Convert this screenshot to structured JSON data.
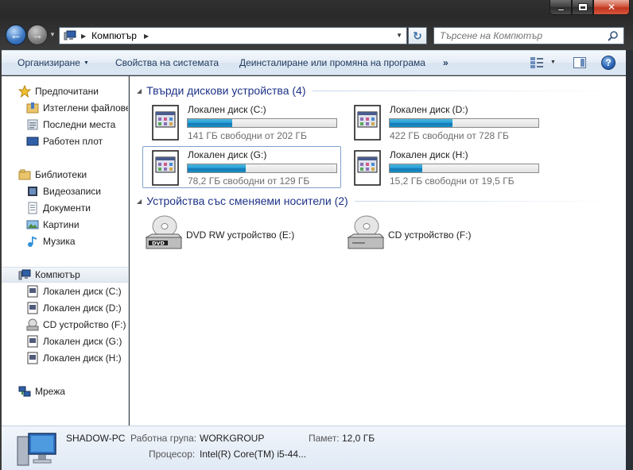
{
  "window": {
    "caption": {
      "minimize": "minimize",
      "maximize": "maximize",
      "close": "✕"
    }
  },
  "address": {
    "location": "Компютър",
    "search_placeholder": "Търсене на Компютър"
  },
  "toolbar": {
    "organize": "Организиране",
    "system_properties": "Свойства на системата",
    "uninstall": "Деинсталиране или промяна на програма",
    "more": "»",
    "help": "?"
  },
  "navpane": {
    "favorites": "Предпочитани",
    "downloads": "Изтеглени файлове",
    "recent": "Последни места",
    "desktop": "Работен плот",
    "libraries": "Библиотеки",
    "videos": "Видеозаписи",
    "documents": "Документи",
    "pictures": "Картини",
    "music": "Музика",
    "computer": "Компютър",
    "drive_c": "Локален диск (C:)",
    "drive_d": "Локален диск (D:)",
    "drive_f": "CD устройство (F:)",
    "drive_g": "Локален диск (G:)",
    "drive_h": "Локален диск (H:)",
    "network": "Мрежа"
  },
  "groups": {
    "hard_drives": "Твърди дискови устройства (4)",
    "removable": "Устройства със сменяеми носители (2)"
  },
  "drives": [
    {
      "name": "Локален диск (C:)",
      "free_text": "141 ГБ свободни от 202 ГБ",
      "used_fraction": 0.3
    },
    {
      "name": "Локален диск (D:)",
      "free_text": "422 ГБ свободни от 728 ГБ",
      "used_fraction": 0.42
    },
    {
      "name": "Локален диск (G:)",
      "free_text": "78,2 ГБ свободни от 129 ГБ",
      "used_fraction": 0.39
    },
    {
      "name": "Локален диск (H:)",
      "free_text": "15,2 ГБ свободни от 19,5 ГБ",
      "used_fraction": 0.22
    }
  ],
  "removable": [
    {
      "name": "DVD RW устройство (E:)",
      "badge": "DVD"
    },
    {
      "name": "CD устройство (F:)"
    }
  ],
  "details": {
    "pc_name": "SHADOW-PC",
    "workgroup_label": "Работна група:",
    "workgroup_value": "WORKGROUP",
    "memory_label": "Памет:",
    "memory_value": "12,0 ГБ",
    "cpu_label": "Процесор:",
    "cpu_value": "Intel(R) Core(TM) i5-44..."
  },
  "colors": {
    "accent": "#1e3287",
    "bar_fill": "#26a0da",
    "titlebar": "#2a2a2a"
  }
}
